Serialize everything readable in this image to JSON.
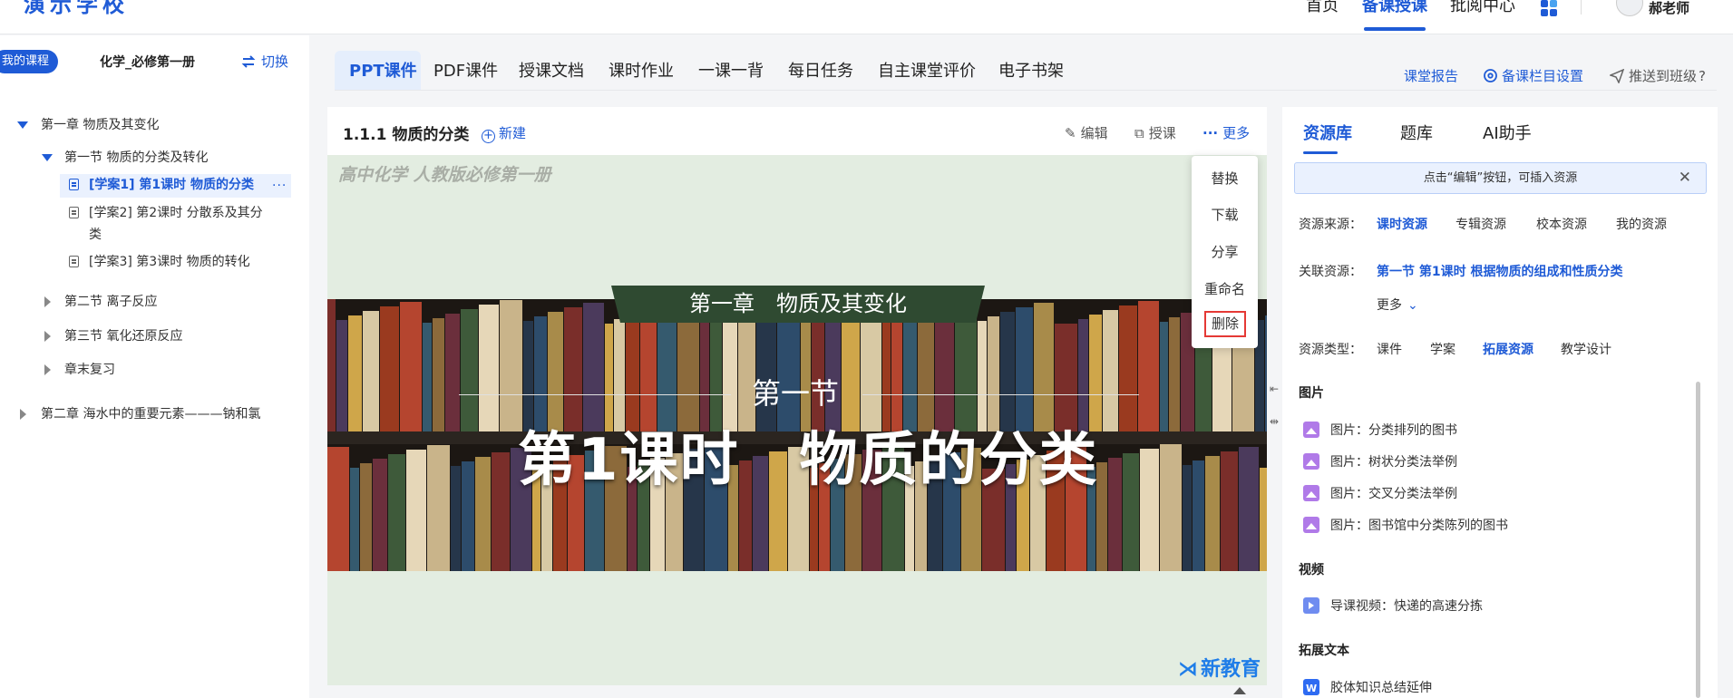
{
  "header": {
    "logo": "演示学校",
    "nav": [
      "首页",
      "备课授课",
      "批阅中心"
    ],
    "active_nav": "备课授课",
    "user": "郝老师"
  },
  "sidebar": {
    "my_course": "我的课程",
    "course_name": "化学_必修第一册",
    "switch": "切换",
    "tree": [
      {
        "label": "第一章 物质及其变化",
        "expanded": true
      },
      {
        "label": "第一节 物质的分类及转化",
        "expanded": true
      },
      {
        "label": "[学案1] 第1课时 物质的分类",
        "active": true
      },
      {
        "label": "[学案2] 第2课时 分散系及其分",
        "label_wrap": "类"
      },
      {
        "label": "[学案3] 第3课时 物质的转化"
      },
      {
        "label": "第二节 离子反应"
      },
      {
        "label": "第三节 氧化还原反应"
      },
      {
        "label": "章末复习"
      },
      {
        "label": "第二章 海水中的重要元素———钠和氯"
      }
    ],
    "item_menu": "···"
  },
  "tabs": [
    "PPT课件",
    "PDF课件",
    "授课文档",
    "课时作业",
    "一课一背",
    "每日任务",
    "自主课堂评价",
    "电子书架"
  ],
  "active_tab": "PPT课件",
  "toolbar_right": {
    "report": "课堂报告",
    "settings": "备课栏目设置",
    "push": "推送到班级",
    "help": "?"
  },
  "panel": {
    "title": "1.1.1 物质的分类",
    "new": "新建",
    "edit": "编辑",
    "teach": "授课",
    "more": "更多"
  },
  "slide": {
    "header": "高中化学 人教版必修第一册",
    "chapter": "第一章　物质及其变化",
    "section": "第一节",
    "lesson": "第1课时　物质的分类",
    "logo": "新教育"
  },
  "more_menu": [
    "替换",
    "下载",
    "分享",
    "重命名",
    "删除"
  ],
  "right_panel": {
    "tabs": [
      "资源库",
      "题库",
      "AI助手"
    ],
    "active_tab": "资源库",
    "hint": "点击“编辑”按钮，可插入资源",
    "source_label": "资源来源：",
    "source_options": [
      "课时资源",
      "专辑资源",
      "校本资源",
      "我的资源"
    ],
    "source_active": "课时资源",
    "related_label": "关联资源：",
    "related_value": "第一节 第1课时 根据物质的组成和性质分类",
    "more": "更多",
    "type_label": "资源类型：",
    "type_options": [
      "课件",
      "学案",
      "拓展资源",
      "教学设计"
    ],
    "type_active": "拓展资源",
    "groups": [
      {
        "title": "图片",
        "items": [
          "图片：分类排列的图书",
          "图片：树状分类法举例",
          "图片：交叉分类法举例",
          "图片：图书馆中分类陈列的图书"
        ]
      },
      {
        "title": "视频",
        "items": [
          "导课视频：快递的高速分拣"
        ]
      },
      {
        "title": "拓展文本",
        "items": [
          "胶体知识总结延伸"
        ]
      }
    ]
  }
}
